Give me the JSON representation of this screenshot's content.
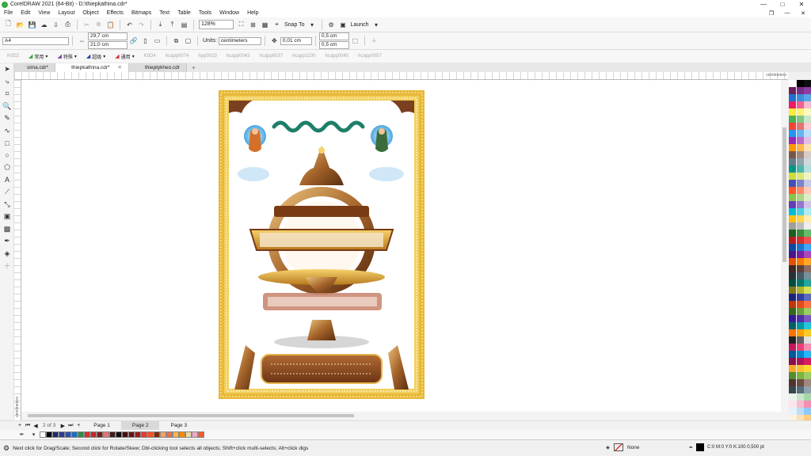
{
  "window": {
    "title": "CorelDRAW 2021 (64-Bit) - D:\\thiepkathina.cdr*",
    "buttons": [
      "—",
      "□",
      "✕"
    ]
  },
  "menu": {
    "items": [
      "File",
      "Edit",
      "View",
      "Layout",
      "Object",
      "Effects",
      "Bitmaps",
      "Text",
      "Table",
      "Tools",
      "Window",
      "Help"
    ]
  },
  "standard_toolbar": {
    "zoom": "128%",
    "snap_to": "Snap To",
    "launch": "Launch"
  },
  "property_bar": {
    "page_size": "A4",
    "width": "29,7 cm",
    "height": "21,0 cm",
    "units_label": "Units:",
    "units_value": "centimeters",
    "nudge": "0,01 cm",
    "dup_x": "0,5 cm",
    "dup_y": "0,5 cm"
  },
  "font_bar": {
    "items": [
      {
        "label": "K0D2",
        "active": false
      },
      {
        "label": "常用",
        "active": true
      },
      {
        "label": "特殊",
        "active": true
      },
      {
        "label": "超级",
        "active": true
      },
      {
        "label": "通用",
        "active": true
      },
      {
        "label": "K0D4",
        "active": false
      },
      {
        "label": "hcapp0074",
        "active": false
      },
      {
        "label": "hpp0023",
        "active": false
      },
      {
        "label": "hcapp0043",
        "active": false
      },
      {
        "label": "hcapp0037",
        "active": false
      },
      {
        "label": "hcapp1100",
        "active": false
      },
      {
        "label": "hcapp0040",
        "active": false
      },
      {
        "label": "hcapp0057",
        "active": false
      }
    ]
  },
  "document_tabs": [
    {
      "label": "sima.cdr*",
      "active": false
    },
    {
      "label": "thiepkathina.cdr*",
      "active": true
    },
    {
      "label": "thieptykheo.cdr",
      "active": false
    }
  ],
  "rulers": {
    "h_unit": "centimeters",
    "v_unit": "centimeters"
  },
  "page_navigator": {
    "counter": "2 of 3",
    "pages": [
      {
        "label": "Page 1",
        "active": false
      },
      {
        "label": "Page 2",
        "active": true
      },
      {
        "label": "Page 3",
        "active": false
      }
    ]
  },
  "status": {
    "message": "Next click for Drag/Scale; Second click for Rotate/Skew; Dbl-clicking tool selects all objects; Shift+click multi-selects; Alt+click digs",
    "fill": "None",
    "outline": "C:0 M:0 Y:0 K:100  0,500 pt"
  },
  "colors": {
    "accent": "#3aa845",
    "frame_gold": "#d9a521",
    "artwork_teal": "#1e7f68",
    "plaque_brown": "#8a4a20"
  },
  "doc_palette": [
    "#ffffff",
    "#000000",
    "#1c2a6b",
    "#2a3b8f",
    "#2f4fb0",
    "#1b6fc2",
    "#2d8b44",
    "#d32f2f",
    "#c62828",
    "#7b1c1c",
    "#e57373",
    "#3e1b1b",
    "#101010",
    "#4a0d0d",
    "#6d1010",
    "#9b1c1c",
    "#e53935",
    "#f4511e",
    "#7a2d0e",
    "#f4a261",
    "#e76f51",
    "#ffb74d",
    "#ff8a00",
    "#e9d8a6",
    "#f4a6c6",
    "#ff5722"
  ],
  "right_palette": [
    "#ffffff",
    "#000000",
    "#0d0d0d",
    "#6b1f5b",
    "#7a2d8a",
    "#8c3ea3",
    "#1e6fd1",
    "#3e8edb",
    "#5aa7e6",
    "#e91e63",
    "#f06292",
    "#f8bbd0",
    "#ffeb3b",
    "#fff176",
    "#fff9c4",
    "#4caf50",
    "#81c784",
    "#c8e6c9",
    "#f44336",
    "#e57373",
    "#ffcdd2",
    "#2196f3",
    "#64b5f6",
    "#bbdefb",
    "#9c27b0",
    "#ba68c8",
    "#e1bee7",
    "#ff9800",
    "#ffb74d",
    "#ffe0b2",
    "#795548",
    "#a1887f",
    "#d7ccc8",
    "#607d8b",
    "#90a4ae",
    "#cfd8dc",
    "#009688",
    "#4db6ac",
    "#b2dfdb",
    "#cddc39",
    "#dce775",
    "#f0f4c3",
    "#3f51b5",
    "#7986cb",
    "#c5cae9",
    "#ff5722",
    "#ff8a65",
    "#ffccbc",
    "#8bc34a",
    "#aed581",
    "#dcedc8",
    "#673ab7",
    "#9575cd",
    "#d1c4e9",
    "#00bcd4",
    "#4dd0e1",
    "#b2ebf2",
    "#ffc107",
    "#ffd54f",
    "#ffecb3",
    "#9e9e9e",
    "#bdbdbd",
    "#eeeeee",
    "#1b5e20",
    "#388e3c",
    "#66bb6a",
    "#b71c1c",
    "#d32f2f",
    "#ef5350",
    "#0d47a1",
    "#1976d2",
    "#42a5f5",
    "#4a148c",
    "#7b1fa2",
    "#ab47bc",
    "#e65100",
    "#f57c00",
    "#ffa726",
    "#3e2723",
    "#5d4037",
    "#8d6e63",
    "#263238",
    "#455a64",
    "#78909c",
    "#004d40",
    "#00796b",
    "#26a69a",
    "#827717",
    "#afb42b",
    "#d4e157",
    "#1a237e",
    "#303f9f",
    "#5c6bc0",
    "#bf360c",
    "#e64a19",
    "#ff7043",
    "#33691e",
    "#689f38",
    "#9ccc65",
    "#311b92",
    "#512da8",
    "#7e57c2",
    "#006064",
    "#0097a7",
    "#26c6da",
    "#ff6f00",
    "#ffa000",
    "#ffca28",
    "#212121",
    "#616161",
    "#e0e0e0",
    "#c2185b",
    "#ec407a",
    "#f48fb1",
    "#01579b",
    "#0288d1",
    "#29b6f6",
    "#880e4f",
    "#ad1457",
    "#d81b60",
    "#f9a825",
    "#fbc02d",
    "#fdd835",
    "#558b2f",
    "#7cb342",
    "#9ccc65",
    "#4e342e",
    "#6d4c41",
    "#a1887f",
    "#37474f",
    "#546e7a",
    "#90a4ae",
    "#e8f5e9",
    "#c8e6c9",
    "#a5d6a7",
    "#fce4ec",
    "#f8bbd0",
    "#f48fb1",
    "#e3f2fd",
    "#bbdefb",
    "#90caf9",
    "#fff3e0",
    "#ffe0b2",
    "#ffcc80"
  ]
}
